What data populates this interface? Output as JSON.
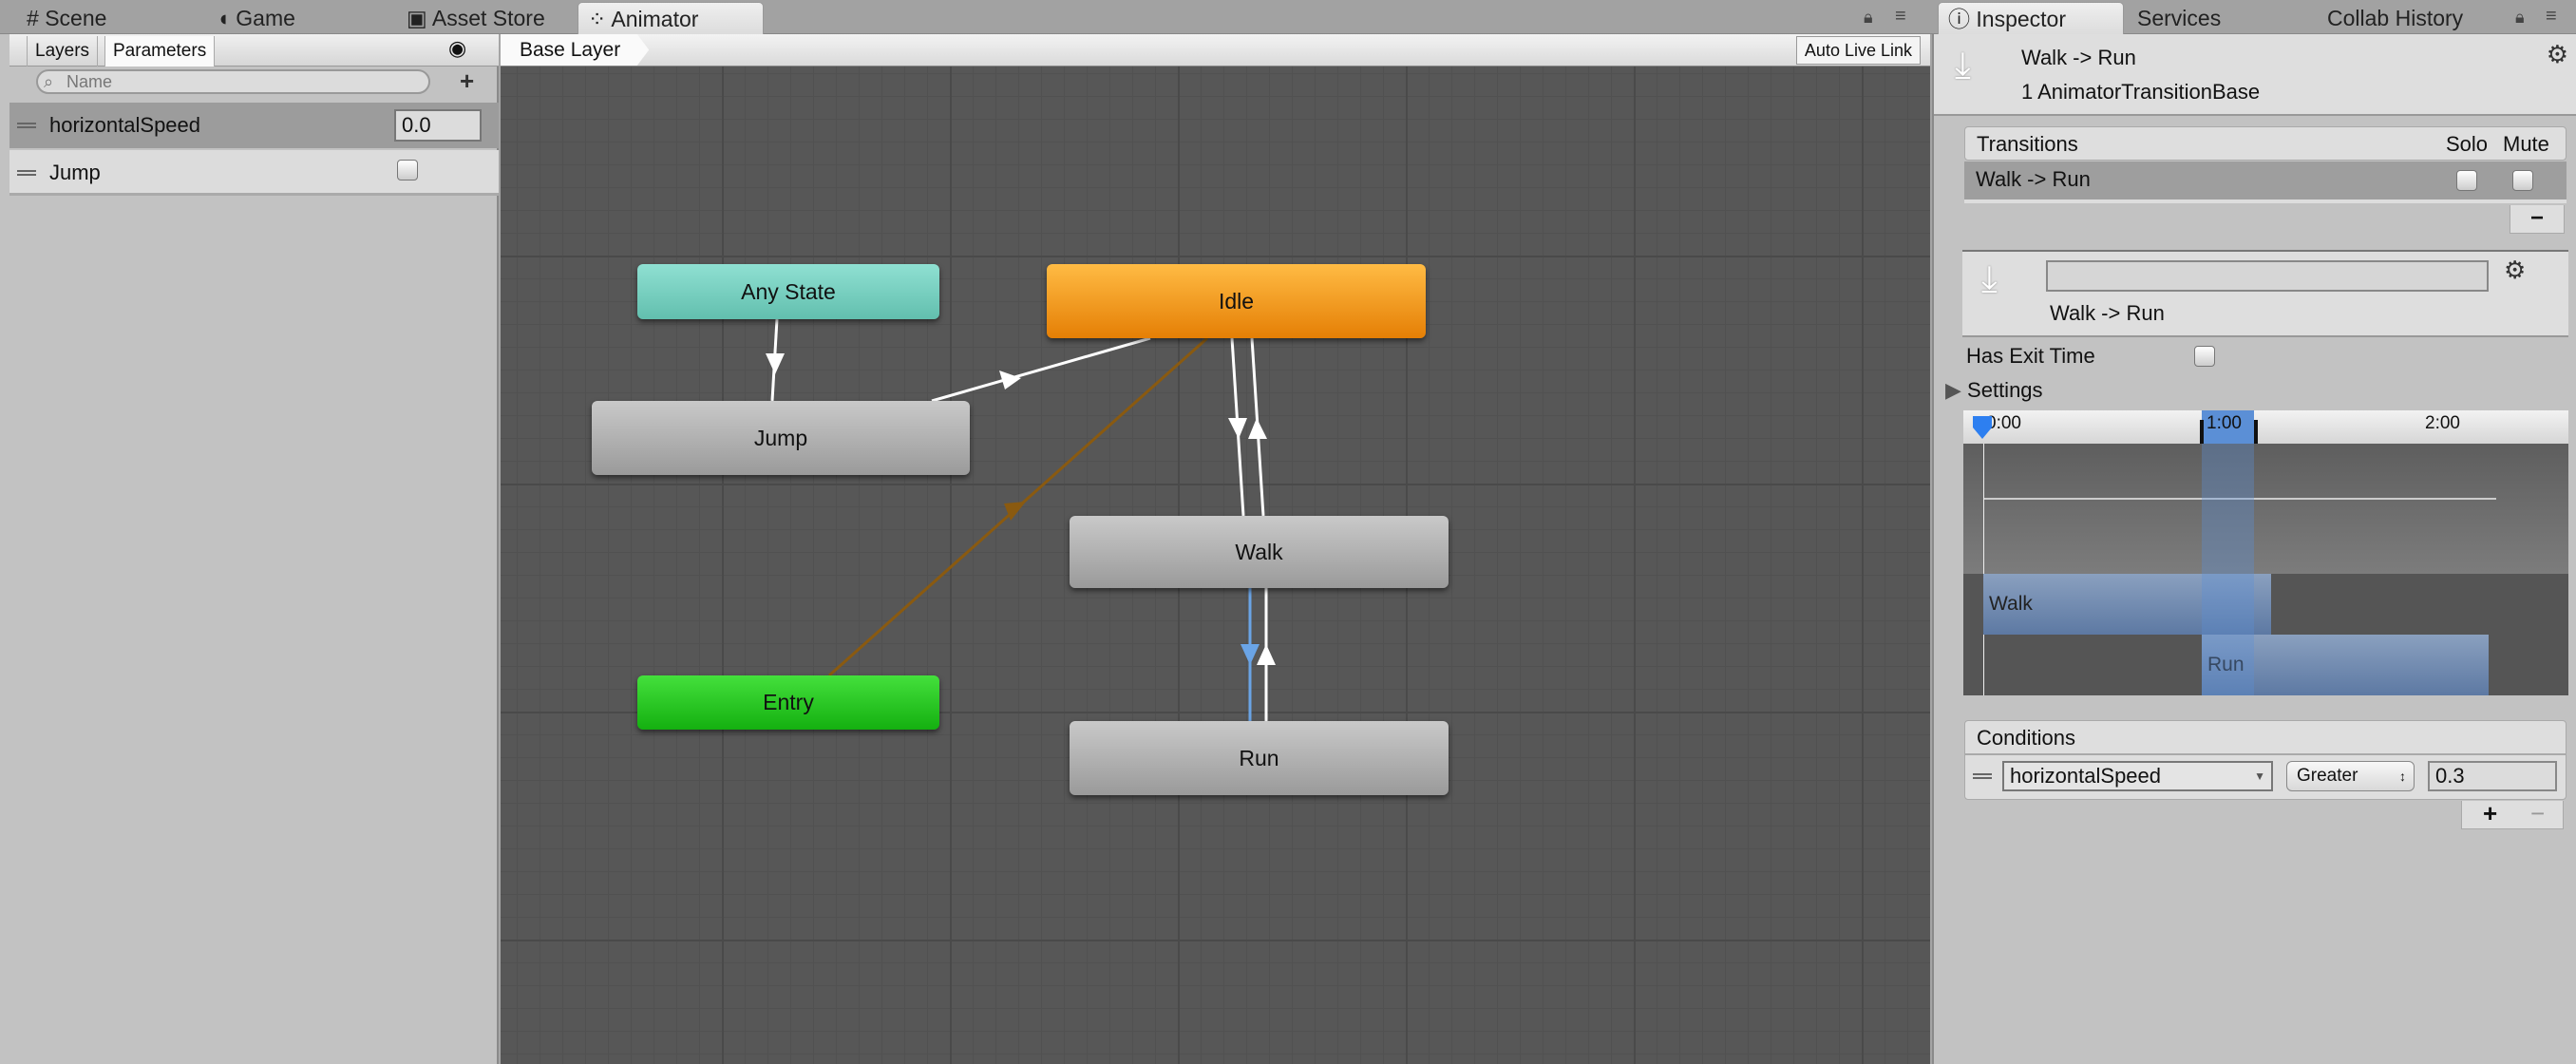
{
  "tabs": {
    "left": [
      {
        "label": "Scene",
        "icon": "grid-icon"
      },
      {
        "label": "Game",
        "icon": "pacman-icon"
      },
      {
        "label": "Asset Store",
        "icon": "bag-icon"
      },
      {
        "label": "Animator",
        "icon": "animator-icon",
        "active": true
      }
    ],
    "right": [
      {
        "label": "Inspector",
        "icon": "info-icon",
        "active": true
      },
      {
        "label": "Services"
      },
      {
        "label": "Collab History"
      }
    ]
  },
  "parameters_panel": {
    "tabs": [
      "Layers",
      "Parameters"
    ],
    "active_tab": "Parameters",
    "search_placeholder": "Name",
    "params": [
      {
        "name": "horizontalSpeed",
        "type": "float",
        "value": "0.0"
      },
      {
        "name": "Jump",
        "type": "trigger",
        "checked": false
      }
    ]
  },
  "graph": {
    "breadcrumb": "Base Layer",
    "auto_live_link": "Auto Live Link",
    "states": {
      "any_state": "Any State",
      "idle": "Idle",
      "jump": "Jump",
      "walk": "Walk",
      "entry": "Entry",
      "run": "Run"
    },
    "colors": {
      "any_state": "#7ccfc0",
      "default_state": "#f29a17",
      "entry": "#22c11e",
      "selected_transition": "#6aa4e6",
      "entry_transition": "#8a5a10"
    }
  },
  "inspector": {
    "title": "Walk -> Run",
    "subtitle": "1 AnimatorTransitionBase",
    "transitions": {
      "header": "Transitions",
      "solo": "Solo",
      "mute": "Mute",
      "rows": [
        {
          "name": "Walk -> Run",
          "solo": false,
          "mute": false
        }
      ]
    },
    "name_field": "",
    "transition_label": "Walk -> Run",
    "has_exit_time_label": "Has Exit Time",
    "has_exit_time": false,
    "settings_label": "Settings",
    "timeline": {
      "ticks": [
        "0:00",
        "1:00",
        "2:00"
      ],
      "clips": [
        "Walk",
        "Run"
      ]
    },
    "conditions": {
      "header": "Conditions",
      "rows": [
        {
          "parameter": "horizontalSpeed",
          "mode": "Greater",
          "value": "0.3"
        }
      ]
    }
  }
}
